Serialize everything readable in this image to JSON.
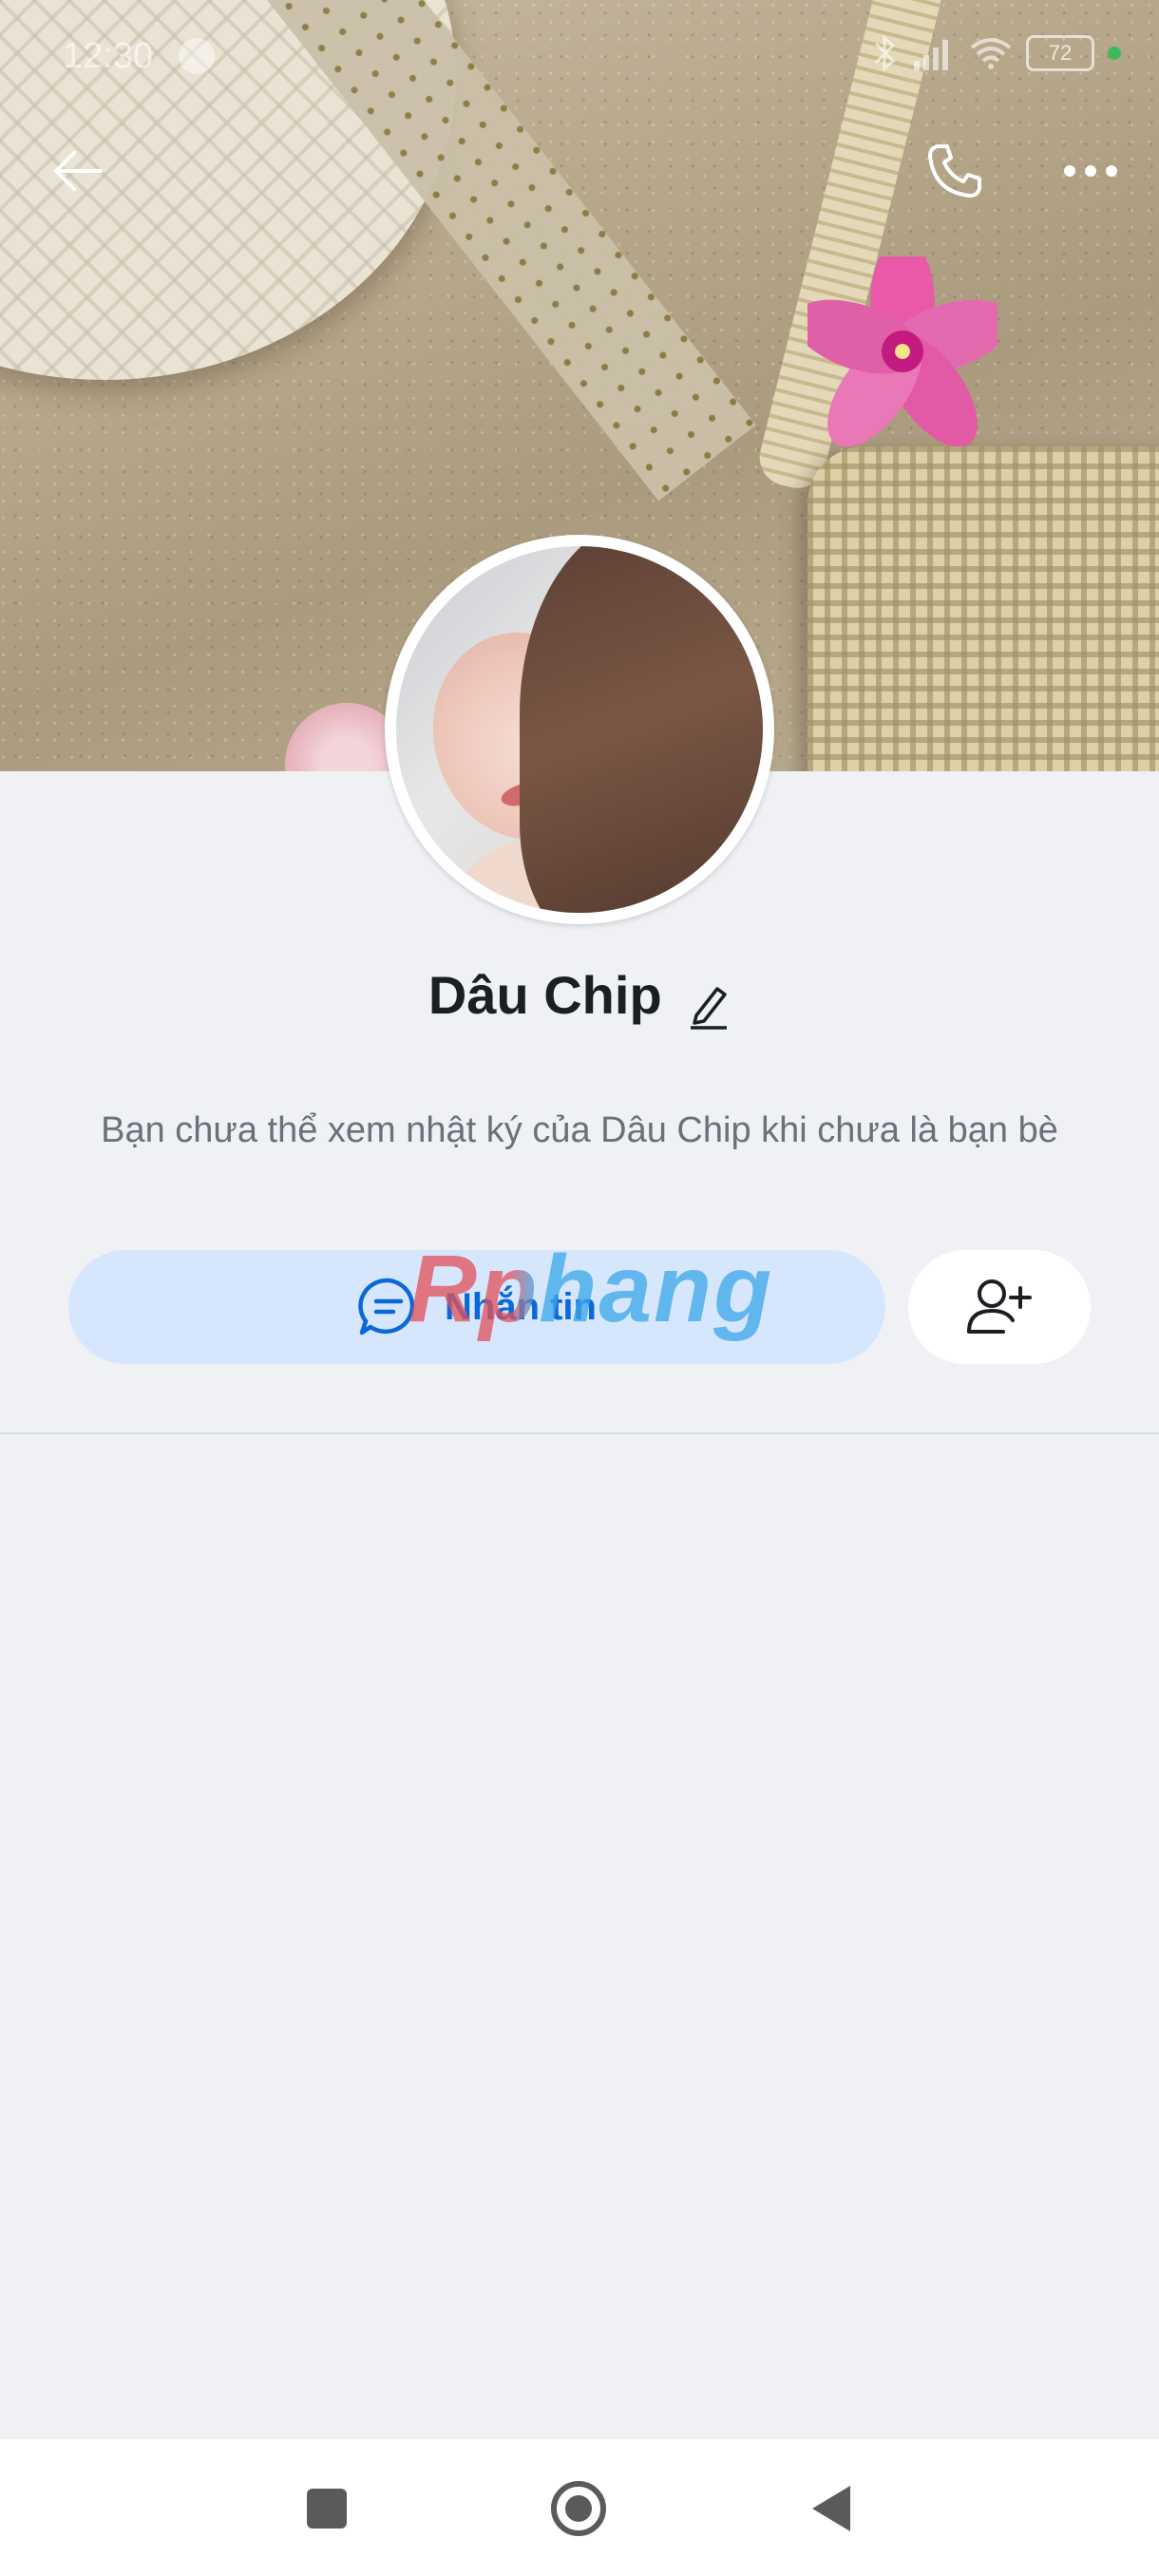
{
  "status_bar": {
    "time": "12:30",
    "battery": "72"
  },
  "profile": {
    "name": "Dâu Chip",
    "description": "Bạn chưa thể xem nhật ký của Dâu Chip khi chưa là bạn bè"
  },
  "actions": {
    "message_label": "Nhắn tin"
  },
  "watermark": "Rphang",
  "icons": {
    "back": "arrow-left-icon",
    "call": "phone-icon",
    "more": "more-horizontal-icon",
    "edit": "pencil-icon",
    "message": "chat-bubble-icon",
    "add_friend": "user-plus-icon"
  },
  "colors": {
    "accent": "#0b68d8",
    "message_button_bg": "#d6e7fd",
    "background": "#eff1f5"
  }
}
